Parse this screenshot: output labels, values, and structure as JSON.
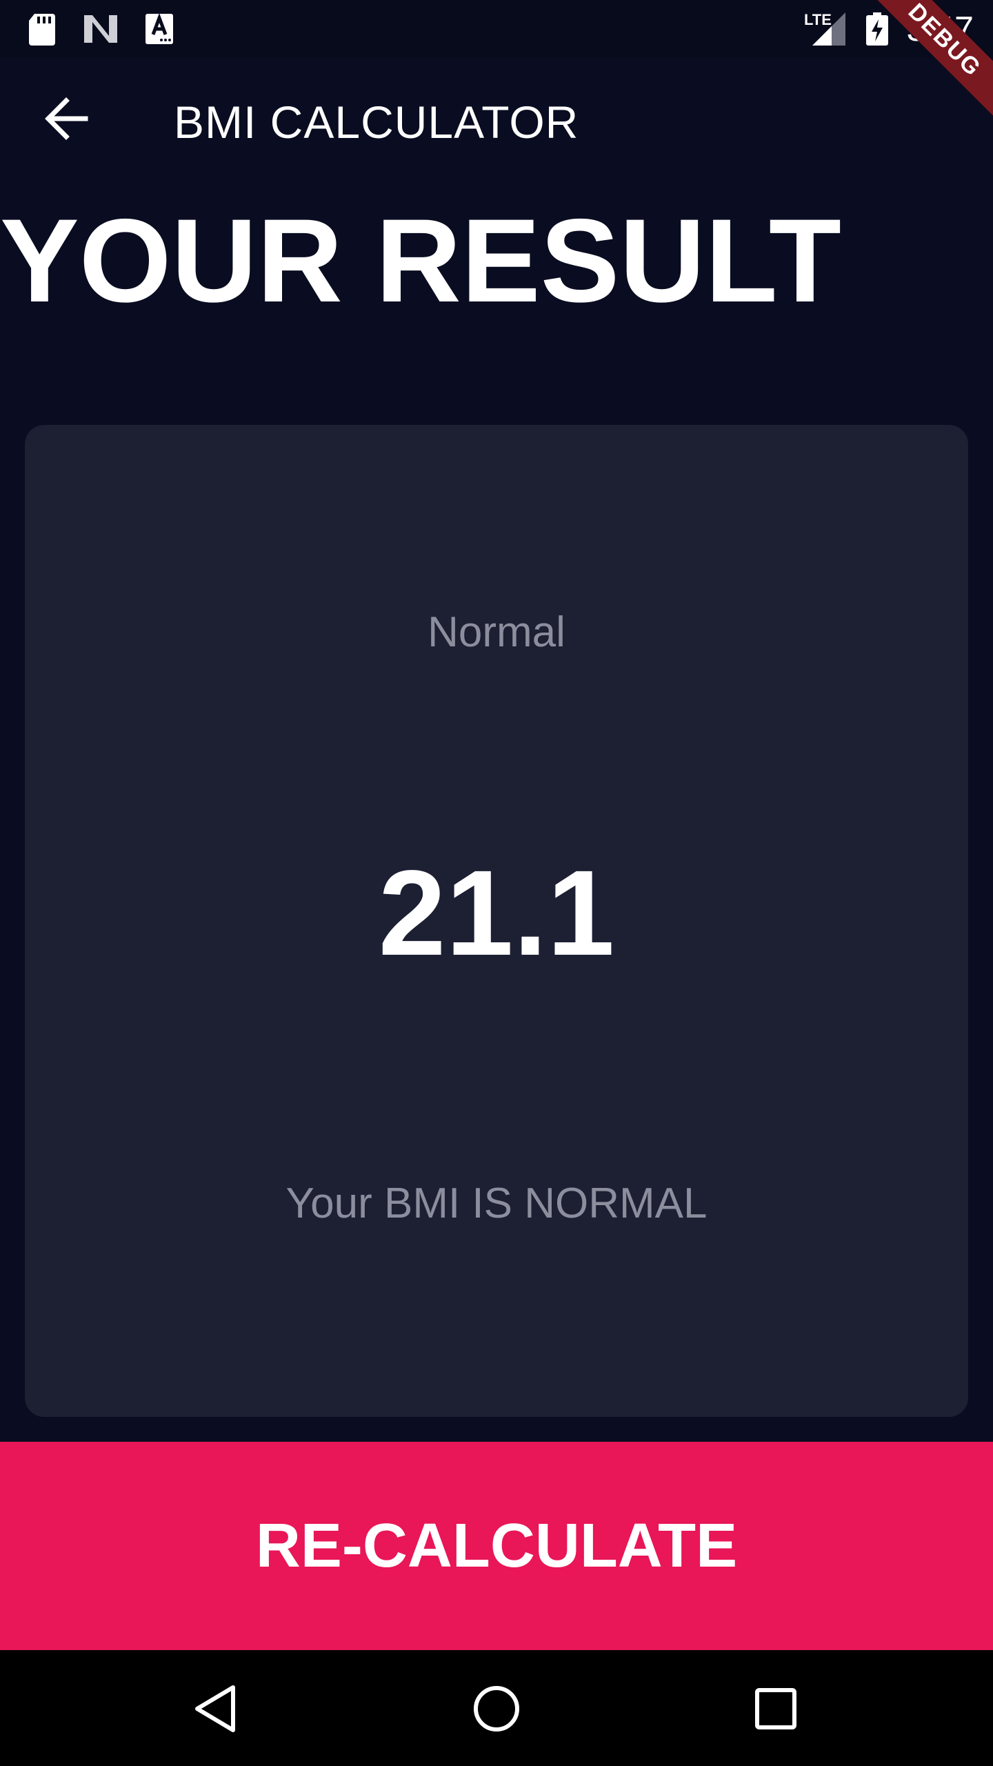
{
  "status_bar": {
    "time": "3:47",
    "network_label": "LTE",
    "icons": [
      "sd-card-icon",
      "n-notification-icon",
      "a-notification-icon",
      "signal-icon",
      "battery-charging-icon"
    ]
  },
  "debug_banner": "DEBUG",
  "app_bar": {
    "title": "BMI CALCULATOR",
    "back_icon": "arrow-back-icon"
  },
  "page_title": "YOUR RESULT",
  "result": {
    "category": "Normal",
    "value": "21.1",
    "message": "Your BMI IS NORMAL"
  },
  "recalculate_label": "RE-CALCULATE",
  "nav_bar": {
    "buttons": [
      "back-icon",
      "home-icon",
      "recents-icon"
    ]
  },
  "colors": {
    "background": "#0a0d21",
    "card": "#1d1f33",
    "accent": "#e91658",
    "muted_text": "#8c8e9e"
  }
}
